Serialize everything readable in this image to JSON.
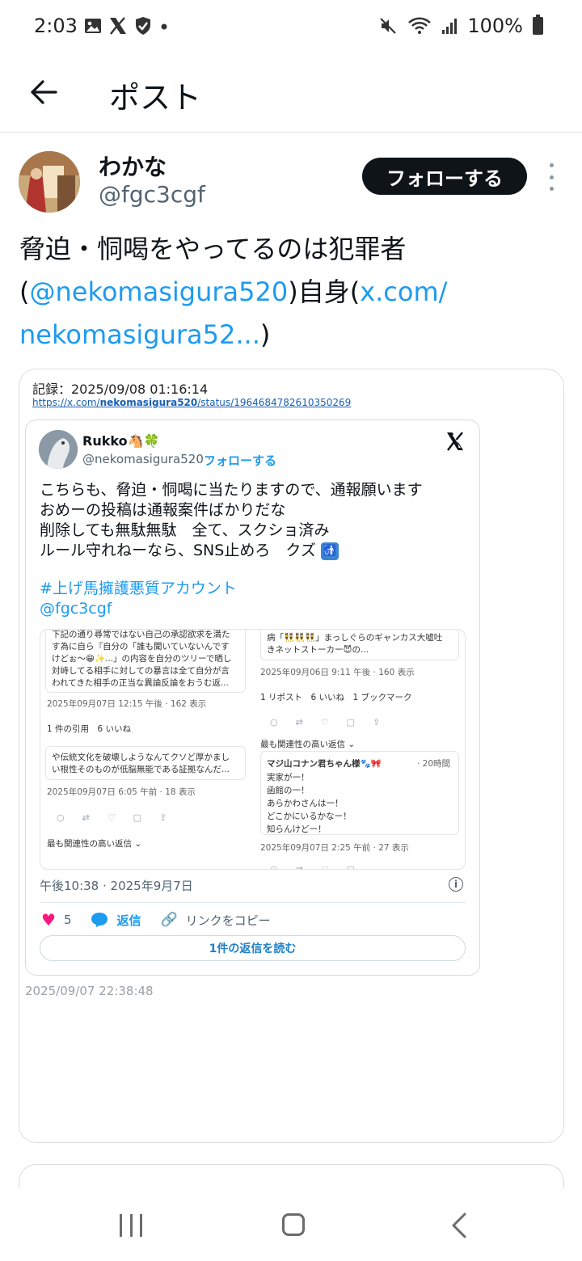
{
  "status_bar": {
    "time": "2:03",
    "battery": "100%",
    "icons": [
      "gallery-icon",
      "x-icon",
      "shield-icon",
      "dot-icon",
      "mute-icon",
      "wifi-icon",
      "signal-icon",
      "battery-icon"
    ]
  },
  "header": {
    "title": "ポスト"
  },
  "author": {
    "name": "わかな",
    "handle": "@fgc3cgf",
    "follow_label": "フォローする"
  },
  "post": {
    "text_line1": "脅迫・恫喝をやってるのは犯罪者",
    "text_open": "(",
    "mention": "@nekomasigura520",
    "text_mid": ")自身(",
    "link_part1": "x.com/",
    "link_part2": "nekomasigura52...",
    "text_close": ")"
  },
  "record": {
    "label": "記録：2025/09/08 01:16:14",
    "url_prefix": "https://x.com/",
    "url_user": "nekomasigura520",
    "url_suffix": "/status/1964684782610350269"
  },
  "embed": {
    "name": "Rukko🐴🍀",
    "handle": "@nekomasigura520 ·",
    "follow_label": "フォローする",
    "lines": [
      "こちらも、脅迫・恫喝に当たりますので、通報願います",
      "おめーの投稿は通報案件ばかりだな",
      "削除しても無駄無駄　全て、スクショ済み",
      "ルール守れねーなら、SNS止めろ　クズ"
    ],
    "hashtag": "#上げ馬擁護悪質アカウント",
    "mention": "@fgc3cgf",
    "timestamp": "午後10:38 · 2025年9月7日",
    "likes": "5",
    "reply_label": "返信",
    "copy_label": "リンクをコピー",
    "read_replies": "1件の返信を読む"
  },
  "shot": {
    "left_1a": "下記の通り尋常ではない自己の承認欲求を満た",
    "left_1b": "す為に自ら『自分の「誰も聞いていないんです",
    "left_1c": "けどぉ〜😁✨...」の内容を自分のツリーで晒し",
    "left_1d": "対峙してる相手に対しての暴言は全て自分が言",
    "left_1e": "われてきた相手の正当な異論反論をおうむ返...",
    "left_1_meta": "2025年09月07日 12:15 午後 · 162 表示",
    "left_1_stats": "1 件の引用　6 いいね",
    "left_2a": "や伝統文化を破壊しようなんてクソど厚かまし",
    "left_2b": "い根性そのものが低脳無能である証拠なんだ...",
    "left_2_meta": "2025年09月07日 6:05 午前 · 18 表示",
    "left_sort": "最も関連性の高い返信 ⌄",
    "right_1a": "病「👯👯👯」まっしぐらのギャンカス大嘘吐",
    "right_1b": "きネットストーカー😈の...",
    "right_1_meta": "2025年09月06日 9:11 午後 · 160 表示",
    "right_1_stats": "1 リポスト　6 いいね　1 ブックマーク",
    "right_sort": "最も関連性の高い返信 ⌄",
    "right_2_name": "マジ山コナン君ちゃん様🐾🎀",
    "right_2_time": "· 20時間",
    "right_2a": "実家が一！",
    "right_2b": "函館の一！",
    "right_2c": "あらかわさんは一！",
    "right_2d": "どこかにいるかなー！",
    "right_2e": "知らんけどー！",
    "right_2_meta": "2025年09月07日 2:25 午前 · 27 表示"
  },
  "record_date": "2025/09/07 22:38:48",
  "colors": {
    "accent": "#1d9bf0",
    "like": "#f91880",
    "follow_bg": "#0f1419"
  }
}
